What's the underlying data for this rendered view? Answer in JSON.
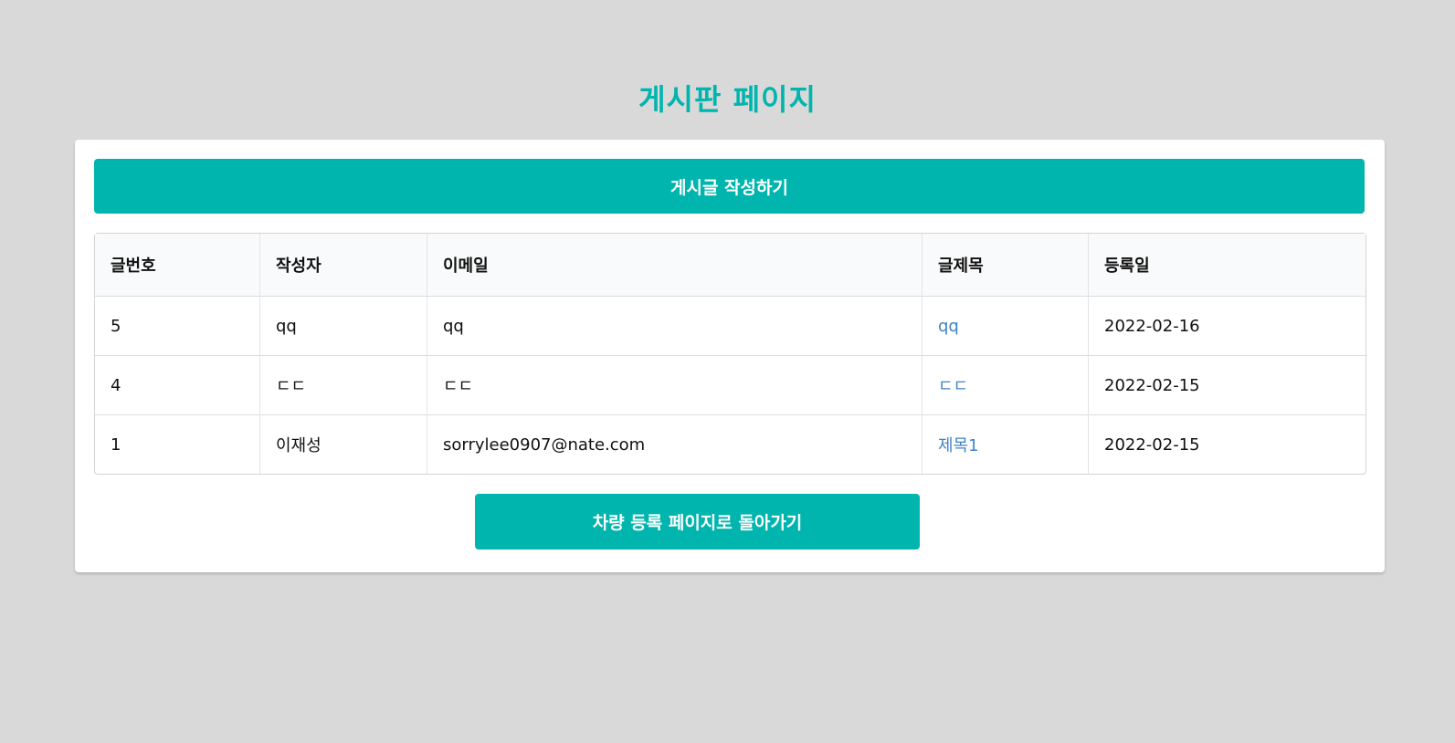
{
  "page": {
    "title": "게시판 페이지"
  },
  "actions": {
    "write_label": "게시글 작성하기",
    "back_label": "차량 등록 페이지로 돌아가기"
  },
  "table": {
    "headers": [
      "글번호",
      "작성자",
      "이메일",
      "글제목",
      "등록일"
    ],
    "rows": [
      {
        "no": "5",
        "author": "qq",
        "email": "qq",
        "title": "qq",
        "date": "2022-02-16"
      },
      {
        "no": "4",
        "author": "ㄷㄷ",
        "email": "ㄷㄷ",
        "title": "ㄷㄷ",
        "date": "2022-02-15"
      },
      {
        "no": "1",
        "author": "이재성",
        "email": "sorrylee0907@nate.com",
        "title": "제목1",
        "date": "2022-02-15"
      }
    ]
  },
  "colors": {
    "accent": "#00b5ad",
    "link": "#4183c4",
    "background": "#d9d9d9"
  }
}
